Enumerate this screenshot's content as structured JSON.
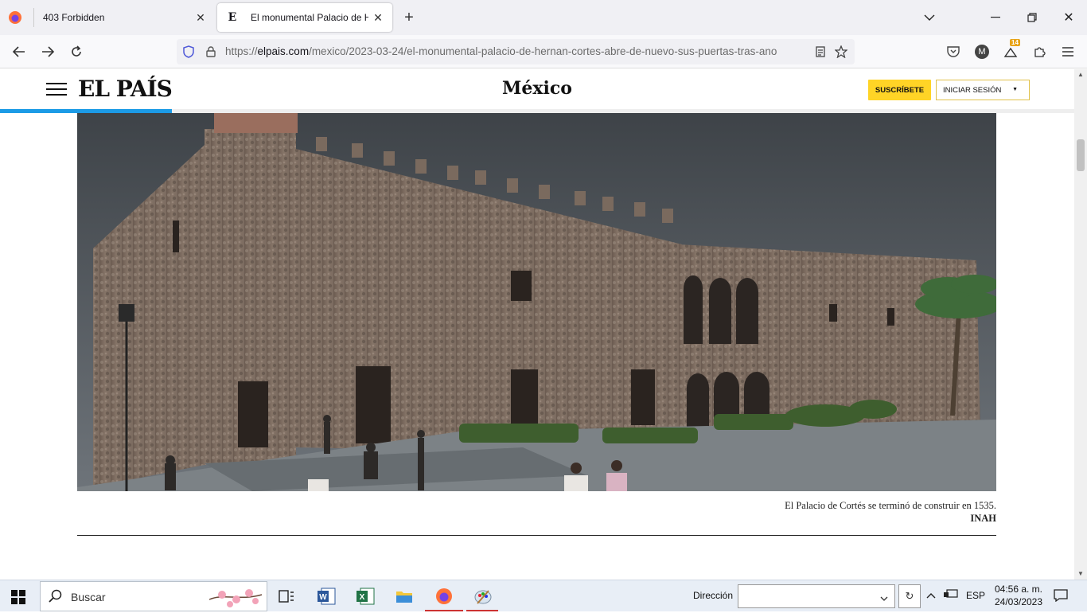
{
  "browser": {
    "tabs": [
      {
        "title": "403 Forbidden",
        "active": false
      },
      {
        "title": "El monumental Palacio de Hern",
        "active": true
      }
    ],
    "url": {
      "prefix": "https://",
      "host": "elpais.com",
      "path": "/mexico/2023-03-24/el-monumental-palacio-de-hernan-cortes-abre-de-nuevo-sus-puertas-tras-ano"
    },
    "extension_badge": "14",
    "account_initial": "M"
  },
  "site": {
    "logo": "EL PAÍS",
    "section": "México",
    "subscribe_label": "SUSCRÍBETE",
    "login_label": "INICIAR SESIÓN",
    "reading_progress_percent": 16,
    "accent_color": "#1c9be6",
    "subscribe_color": "#ffd426"
  },
  "article": {
    "caption": "El Palacio de Cortés se terminó de construir en 1535.",
    "credit": "INAH"
  },
  "taskbar": {
    "search_label": "Buscar",
    "address_label": "Dirección",
    "address_value": "",
    "language": "ESP",
    "time": "04:56 a. m.",
    "date": "24/03/2023"
  }
}
